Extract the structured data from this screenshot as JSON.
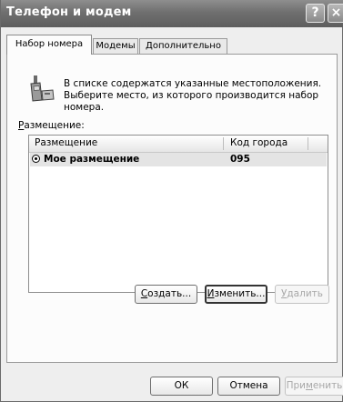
{
  "window": {
    "title": "Телефон и модем",
    "help_button": "?",
    "close_button": "×"
  },
  "tabs": [
    {
      "label": "Набор номера",
      "active": true
    },
    {
      "label": "Модемы",
      "active": false
    },
    {
      "label": "Дополнительно",
      "active": false
    }
  ],
  "info": {
    "line1": "В списке содержатся указанные местоположения.",
    "line2": "Выберите место, из которого производится набор номера."
  },
  "locations": {
    "label_prefix": "",
    "label_underlined": "Р",
    "label_rest": "азмещение:",
    "columns": [
      "Размещение",
      "Код города"
    ],
    "rows": [
      {
        "name": "Мое размещение",
        "area_code": "095",
        "selected": true
      }
    ]
  },
  "buttons": {
    "create": {
      "prefix": "",
      "u": "С",
      "rest": "оздать..."
    },
    "edit": {
      "prefix": "",
      "u": "И",
      "rest": "зменить..."
    },
    "delete": {
      "prefix": "",
      "u": "У",
      "rest": "далить"
    },
    "ok": "ОК",
    "cancel": "Отмена",
    "apply": {
      "prefix": "При",
      "u": "м",
      "rest": "енить"
    }
  }
}
